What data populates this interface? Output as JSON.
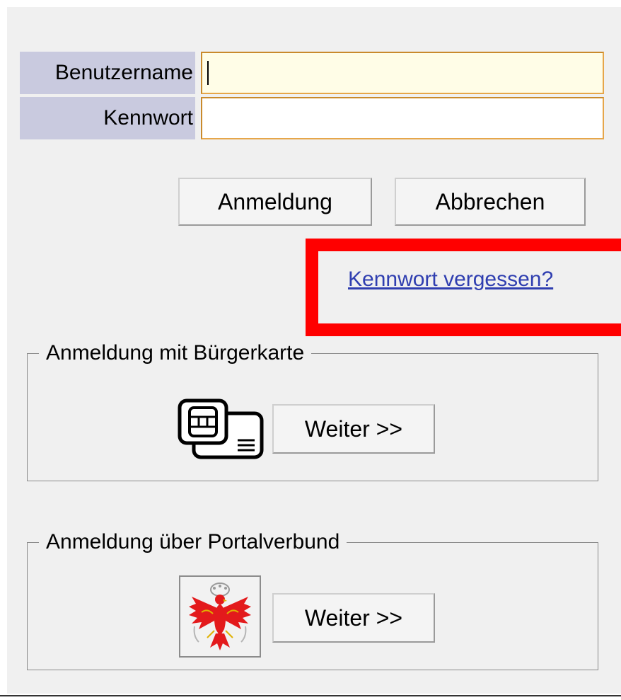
{
  "login": {
    "username_label": "Benutzername",
    "username_value": "",
    "password_label": "Kennwort",
    "password_value": "",
    "login_button": "Anmeldung",
    "cancel_button": "Abbrechen",
    "forgot_link": "Kennwort vergessen?"
  },
  "citizen_card": {
    "legend": "Anmeldung mit Bürgerkarte",
    "icon": "smart-card-icon",
    "button": "Weiter >>"
  },
  "portal": {
    "legend": "Anmeldung über Portalverbund",
    "icon": "tyrol-eagle-emblem",
    "button": "Weiter >>"
  },
  "colors": {
    "label_bg": "#c9cadf",
    "input_border": "#e6a64a",
    "focused_input_bg": "#fffde7",
    "highlight": "#ff0000",
    "link": "#2f3eb0",
    "eagle_red": "#e31a1c"
  }
}
